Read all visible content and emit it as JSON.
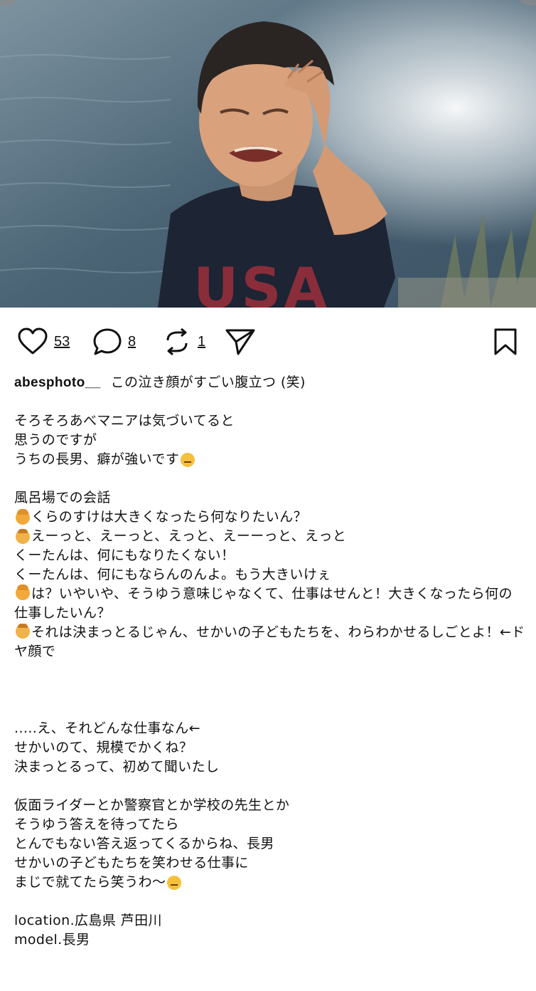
{
  "post": {
    "photo_alt": "",
    "actions": {
      "likes": "53",
      "comments": "8",
      "reposts": "1"
    },
    "username": "abesphoto__",
    "caption_title": "この泣き顔がすごい腹立つ (笑)",
    "paragraph1": [
      "そろそろあべマニアは気づいてると",
      "思うのですが",
      "うちの長男、癖が強いです"
    ],
    "dialogue_heading": "風呂場での会話",
    "dialogue": [
      "くらのすけは大きくなったら何なりたいん？",
      "えーっと、えーっと、えっと、えーーっと、えっと",
      "くーたんは、何にもなりたくない！",
      "くーたんは、何にもならんのんよ。もう大きいけぇ",
      "は？いやいや、そうゆう意味じゃなくて、仕事はせんと！大きくなったら何の仕事したいん？",
      "それは決まっとるじゃん、せかいの子どもたちを、わらわかせるしごとよ！←ドヤ顔で"
    ],
    "paragraph3": [
      ".....え、それどんな仕事なん←",
      "せかいのて、規模でかくね？",
      "決まっとるって、初めて聞いたし"
    ],
    "paragraph4": [
      "仮面ライダーとか警察官とか学校の先生とか",
      "そうゆう答えを待ってたら",
      "とんでもない答え返ってくるからね、長男",
      "せかいの子どもたちを笑わせる仕事に",
      "まじで就てたら笑うわ〜"
    ],
    "location": "location.広島県 芦田川",
    "model": "model.長男"
  },
  "colors": {
    "text": "#111111",
    "background": "#ffffff",
    "emoji": "#f5c13c"
  },
  "icons": [
    "heart-icon",
    "comment-icon",
    "repost-icon",
    "share-icon",
    "bookmark-icon"
  ]
}
